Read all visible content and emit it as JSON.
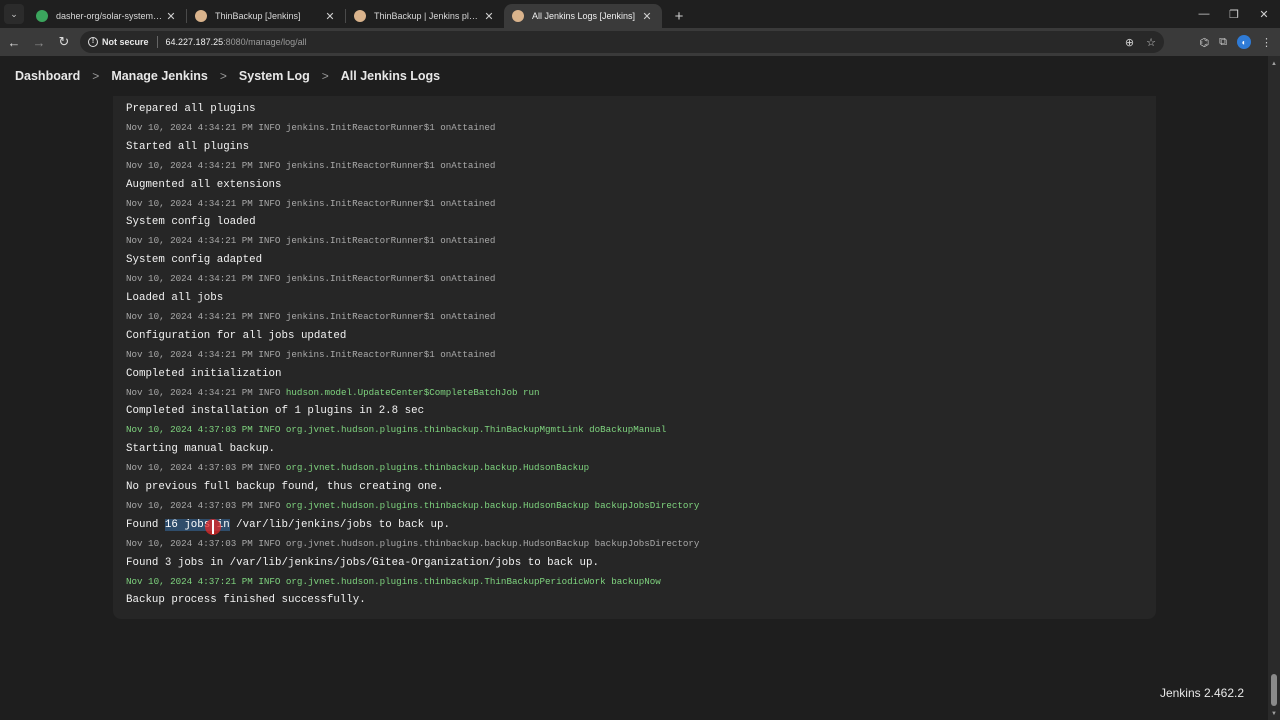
{
  "browser": {
    "tabs": [
      {
        "title": "dasher-org/solar-system - solar",
        "favicon_color": "#3ba55d",
        "active": false
      },
      {
        "title": "ThinBackup [Jenkins]",
        "favicon_color": "#d9b38c",
        "active": false
      },
      {
        "title": "ThinBackup | Jenkins plugin",
        "favicon_color": "#d9b38c",
        "active": false
      },
      {
        "title": "All Jenkins Logs [Jenkins]",
        "favicon_color": "#d9b38c",
        "active": true
      }
    ],
    "address": {
      "security_label": "Not secure",
      "host": "64.227.187.25",
      "path": ":8080/manage/log/all"
    }
  },
  "breadcrumbs": [
    "Dashboard",
    "Manage Jenkins",
    "System Log",
    "All Jenkins Logs"
  ],
  "log": [
    {
      "kind": "msg",
      "text": "Prepared all plugins"
    },
    {
      "kind": "meta",
      "ts": "Nov 10, 2024 4:34:21 PM",
      "level": "INFO",
      "src": "jenkins.InitReactorRunner$1 onAttained",
      "green": false
    },
    {
      "kind": "msg",
      "text": "Started all plugins"
    },
    {
      "kind": "meta",
      "ts": "Nov 10, 2024 4:34:21 PM",
      "level": "INFO",
      "src": "jenkins.InitReactorRunner$1 onAttained",
      "green": false
    },
    {
      "kind": "msg",
      "text": "Augmented all extensions"
    },
    {
      "kind": "meta",
      "ts": "Nov 10, 2024 4:34:21 PM",
      "level": "INFO",
      "src": "jenkins.InitReactorRunner$1 onAttained",
      "green": false
    },
    {
      "kind": "msg",
      "text": "System config loaded"
    },
    {
      "kind": "meta",
      "ts": "Nov 10, 2024 4:34:21 PM",
      "level": "INFO",
      "src": "jenkins.InitReactorRunner$1 onAttained",
      "green": false
    },
    {
      "kind": "msg",
      "text": "System config adapted"
    },
    {
      "kind": "meta",
      "ts": "Nov 10, 2024 4:34:21 PM",
      "level": "INFO",
      "src": "jenkins.InitReactorRunner$1 onAttained",
      "green": false
    },
    {
      "kind": "msg",
      "text": "Loaded all jobs"
    },
    {
      "kind": "meta",
      "ts": "Nov 10, 2024 4:34:21 PM",
      "level": "INFO",
      "src": "jenkins.InitReactorRunner$1 onAttained",
      "green": false
    },
    {
      "kind": "msg",
      "text": "Configuration for all jobs updated"
    },
    {
      "kind": "meta",
      "ts": "Nov 10, 2024 4:34:21 PM",
      "level": "INFO",
      "src": "jenkins.InitReactorRunner$1 onAttained",
      "green": false
    },
    {
      "kind": "msg",
      "text": "Completed initialization"
    },
    {
      "kind": "meta",
      "ts": "Nov 10, 2024 4:34:21 PM",
      "level": "INFO",
      "src": "hudson.model.UpdateCenter$CompleteBatchJob run",
      "green": "src"
    },
    {
      "kind": "msg",
      "text": "Completed installation of 1 plugins in 2.8 sec"
    },
    {
      "kind": "meta",
      "ts": "Nov 10, 2024 4:37:03 PM",
      "level": "INFO",
      "src": "org.jvnet.hudson.plugins.thinbackup.ThinBackupMgmtLink doBackupManual",
      "green": "all"
    },
    {
      "kind": "msg",
      "text": "Starting manual backup."
    },
    {
      "kind": "meta",
      "ts": "Nov 10, 2024 4:37:03 PM",
      "level": "INFO",
      "src": "org.jvnet.hudson.plugins.thinbackup.backup.HudsonBackup",
      "green": "src"
    },
    {
      "kind": "msg",
      "text": "No previous full backup found, thus creating one."
    },
    {
      "kind": "meta",
      "ts": "Nov 10, 2024 4:37:03 PM",
      "level": "INFO",
      "src": "org.jvnet.hudson.plugins.thinbackup.backup.HudsonBackup backupJobsDirectory",
      "green": "src"
    },
    {
      "kind": "msg",
      "text": "Found 16 jobs in /var/lib/jenkins/jobs to back up.",
      "selected_prefix": "Found ",
      "selected": "16 jobs in",
      "selected_suffix": " /var/lib/jenkins/jobs to back up."
    },
    {
      "kind": "meta",
      "ts": "Nov 10, 2024 4:37:03 PM",
      "level": "INFO",
      "src": "org.jvnet.hudson.plugins.thinbackup.backup.HudsonBackup backupJobsDirectory",
      "green": false
    },
    {
      "kind": "msg",
      "text": "Found 3 jobs in /var/lib/jenkins/jobs/Gitea-Organization/jobs to back up."
    },
    {
      "kind": "meta",
      "ts": "Nov 10, 2024 4:37:21 PM",
      "level": "INFO",
      "src": "org.jvnet.hudson.plugins.thinbackup.ThinBackupPeriodicWork backupNow",
      "green": "all"
    },
    {
      "kind": "msg",
      "text": "Backup process finished successfully."
    }
  ],
  "footer": {
    "version": "Jenkins 2.462.2"
  },
  "colors": {
    "accent_green": "#7fd47f",
    "selection": "#2f4d6b",
    "cursor": "#e62828"
  }
}
